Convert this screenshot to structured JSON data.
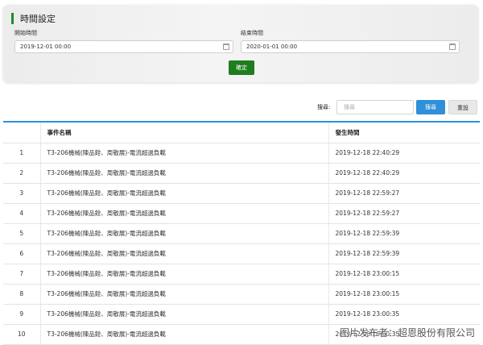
{
  "panel": {
    "title": "時間設定",
    "accent_color": "#1e8a2a"
  },
  "start": {
    "label": "開始時間",
    "value": "2019-12-01 00:00"
  },
  "end": {
    "label": "結束時間",
    "value": "2020-01-01 00:00"
  },
  "confirm_label": "確定",
  "search": {
    "label": "搜尋:",
    "placeholder": "搜尋",
    "button_label": "搜尋",
    "reset_label": "重設"
  },
  "table": {
    "headers": [
      "",
      "事件名稱",
      "發生時間"
    ],
    "rows": [
      {
        "idx": "1",
        "name": "T3-206機械(陳品銓、周敬展)-電流超過負載",
        "time": "2019-12-18 22:40:29"
      },
      {
        "idx": "2",
        "name": "T3-206機械(陳品銓、周敬展)-電流超過負載",
        "time": "2019-12-18 22:40:29"
      },
      {
        "idx": "3",
        "name": "T3-206機械(陳品銓、周敬展)-電流超過負載",
        "time": "2019-12-18 22:59:27"
      },
      {
        "idx": "4",
        "name": "T3-206機械(陳品銓、周敬展)-電流超過負載",
        "time": "2019-12-18 22:59:27"
      },
      {
        "idx": "5",
        "name": "T3-206機械(陳品銓、周敬展)-電流超過負載",
        "time": "2019-12-18 22:59:39"
      },
      {
        "idx": "6",
        "name": "T3-206機械(陳品銓、周敬展)-電流超過負載",
        "time": "2019-12-18 22:59:39"
      },
      {
        "idx": "7",
        "name": "T3-206機械(陳品銓、周敬展)-電流超過負載",
        "time": "2019-12-18 23:00:15"
      },
      {
        "idx": "8",
        "name": "T3-206機械(陳品銓、周敬展)-電流超過負載",
        "time": "2019-12-18 23:00:15"
      },
      {
        "idx": "9",
        "name": "T3-206機械(陳品銓、周敬展)-電流超過負載",
        "time": "2019-12-18 23:00:35"
      },
      {
        "idx": "10",
        "name": "T3-206機械(陳品銓、周敬展)-電流超過負載",
        "time": "2019-12-18 23:00:35"
      }
    ]
  },
  "watermark": "图片发布者：超恩股份有限公司",
  "colors": {
    "header_border": "#2f8fd8",
    "confirm_bg": "#1e7e1e",
    "search_bg": "#2f8fd8"
  },
  "icons": {
    "date_picker": "calendar-icon"
  }
}
